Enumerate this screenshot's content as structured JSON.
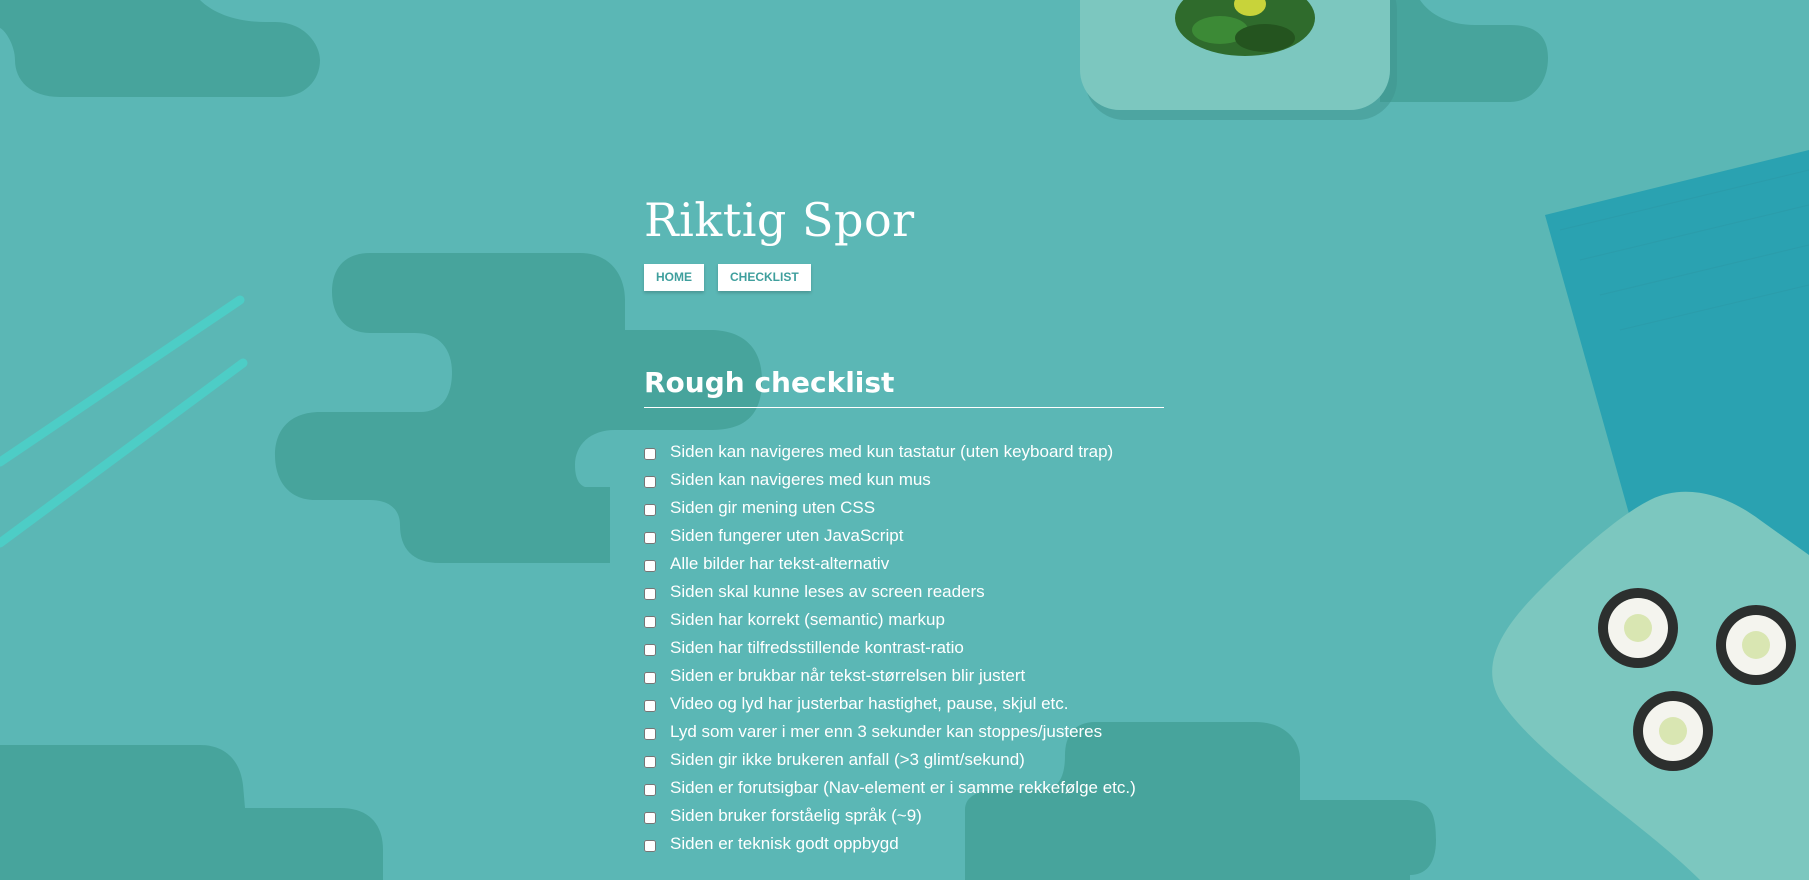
{
  "site": {
    "logo_text": "Riktig Spor"
  },
  "nav": {
    "items": [
      {
        "label": "HOME"
      },
      {
        "label": "CHECKLIST"
      }
    ]
  },
  "main": {
    "title": "Rough checklist",
    "checklist": [
      {
        "label": "Siden kan navigeres med kun tastatur (uten keyboard trap)",
        "checked": false
      },
      {
        "label": "Siden kan navigeres med kun mus",
        "checked": false
      },
      {
        "label": "Siden gir mening uten CSS",
        "checked": false
      },
      {
        "label": "Siden fungerer uten JavaScript",
        "checked": false
      },
      {
        "label": "Alle bilder har tekst-alternativ",
        "checked": false
      },
      {
        "label": "Siden skal kunne leses av screen readers",
        "checked": false
      },
      {
        "label": "Siden har korrekt (semantic) markup",
        "checked": false
      },
      {
        "label": "Siden har tilfredsstillende kontrast-ratio",
        "checked": false
      },
      {
        "label": "Siden er brukbar når tekst-størrelsen blir justert",
        "checked": false
      },
      {
        "label": "Video og lyd har justerbar hastighet, pause, skjul etc.",
        "checked": false
      },
      {
        "label": "Lyd som varer i mer enn 3 sekunder kan stoppes/justeres",
        "checked": false
      },
      {
        "label": "Siden gir ikke brukeren anfall (>3 glimt/sekund)",
        "checked": false
      },
      {
        "label": "Siden er forutsigbar (Nav-element er i samme rekkefølge etc.)",
        "checked": false
      },
      {
        "label": "Siden bruker forståelig språk (~9)",
        "checked": false
      },
      {
        "label": "Siden er teknisk godt oppbygd",
        "checked": false
      }
    ]
  },
  "colors": {
    "background": "#5bb7b5",
    "blob": "#47a49c",
    "plate": "#7cc7bf",
    "nav_text": "#3f9f9d"
  }
}
